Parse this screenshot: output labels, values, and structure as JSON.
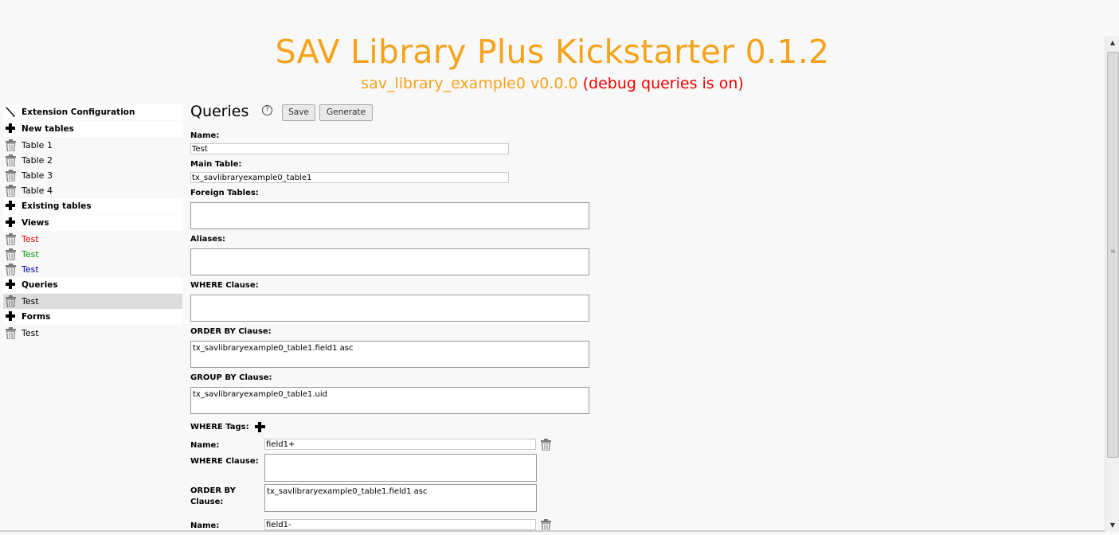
{
  "header": {
    "title": "SAV Library Plus Kickstarter 0.1.2",
    "subtitle_ext": "sav_library_example0 v0.0.0",
    "subtitle_debug": "(debug queries is on)"
  },
  "sidebar": {
    "extension_config": "Extension Configuration",
    "new_tables": "New tables",
    "tables": [
      "Table 1",
      "Table 2",
      "Table 3",
      "Table 4"
    ],
    "existing_tables": "Existing tables",
    "views_label": "Views",
    "views": [
      {
        "label": "Test",
        "color": "#dd0000"
      },
      {
        "label": "Test",
        "color": "#009900"
      },
      {
        "label": "Test",
        "color": "#0000aa"
      }
    ],
    "queries_label": "Queries",
    "queries": [
      "Test"
    ],
    "forms_label": "Forms",
    "forms": [
      "Test"
    ]
  },
  "main": {
    "title": "Queries",
    "help": "?",
    "save": "Save",
    "generate": "Generate",
    "name_label": "Name:",
    "name_value": "Test",
    "main_table_label": "Main Table:",
    "main_table_value": "tx_savlibraryexample0_table1",
    "foreign_tables_label": "Foreign Tables:",
    "foreign_tables_value": "",
    "aliases_label": "Aliases:",
    "aliases_value": "",
    "where_label": "WHERE Clause:",
    "where_value": "",
    "order_label": "ORDER BY Clause:",
    "order_value": "tx_savlibraryexample0_table1.field1 asc",
    "group_label": "GROUP BY Clause:",
    "group_value": "tx_savlibraryexample0_table1.uid",
    "where_tags_label": "WHERE Tags:",
    "tags": [
      {
        "name_label": "Name:",
        "name_value": "field1+",
        "where_label": "WHERE Clause:",
        "where_value": "",
        "order_label": "ORDER BY Clause:",
        "order_value": "tx_savlibraryexample0_table1.field1 asc"
      },
      {
        "name_label": "Name:",
        "name_value": "field1-"
      }
    ]
  },
  "colors": {
    "accent": "#f7a21b",
    "debug": "#e00000"
  }
}
